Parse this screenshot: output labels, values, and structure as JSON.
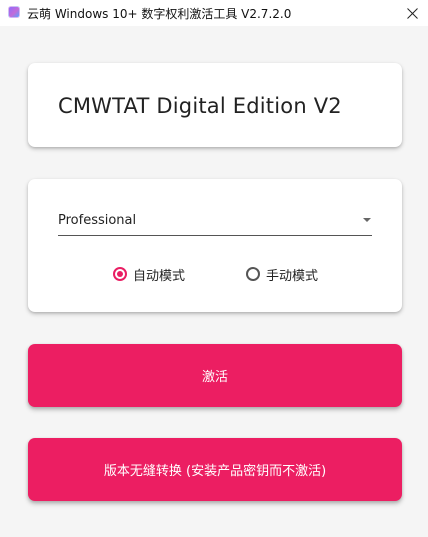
{
  "window": {
    "title": "云萌 Windows 10+ 数字权利激活工具 V2.7.2.0",
    "icon": "app-logo-icon",
    "close_icon": "close-icon"
  },
  "header_card": {
    "title": "CMWTAT Digital Edition V2"
  },
  "options_card": {
    "edition_select": {
      "selected": "Professional"
    },
    "modes": [
      {
        "label": "自动模式",
        "checked": true
      },
      {
        "label": "手动模式",
        "checked": false
      }
    ]
  },
  "buttons": {
    "activate": "激活",
    "convert": "版本无缝转换 (安装产品密钥而不激活)"
  },
  "colors": {
    "accent": "#ec1e62",
    "radio_checked": "#e91e63",
    "background": "#f5f5f5"
  }
}
